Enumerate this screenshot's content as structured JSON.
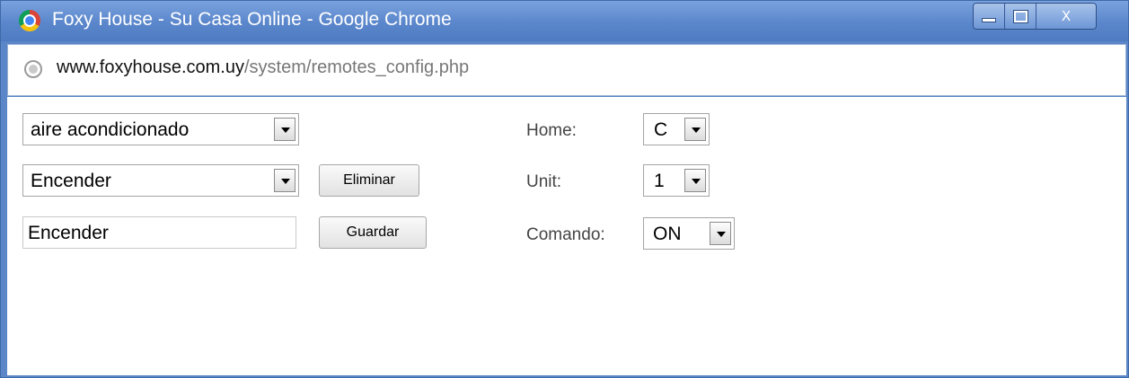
{
  "window": {
    "title": "Foxy House - Su Casa Online - Google Chrome",
    "controls": {
      "minimize": "minimize",
      "maximize": "maximize",
      "close": "X"
    }
  },
  "address": {
    "domain": "www.foxyhouse.com.uy",
    "path": "/system/remotes_config.php"
  },
  "form": {
    "device_select": "aire acondicionado",
    "action_select": "Encender",
    "delete_button": "Eliminar",
    "name_input": "Encender",
    "save_button": "Guardar",
    "home_label": "Home:",
    "home_value": "C",
    "unit_label": "Unit:",
    "unit_value": "1",
    "command_label": "Comando:",
    "command_value": "ON"
  },
  "colors": {
    "titlebar": "#5a86cb",
    "frame": "#3f6aa8"
  },
  "icons": [
    "chrome-icon",
    "globe-icon",
    "minimize-icon",
    "maximize-icon",
    "close-icon",
    "dropdown-arrow-icon"
  ]
}
